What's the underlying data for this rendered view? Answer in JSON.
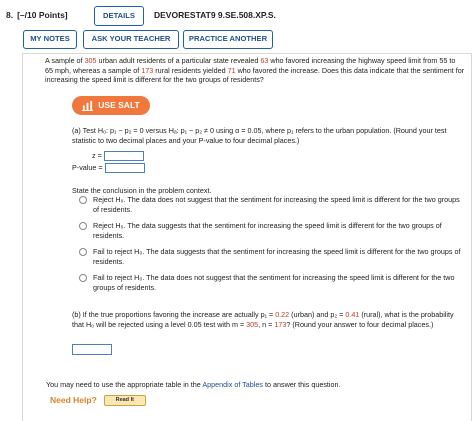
{
  "header": {
    "question_number": "8.",
    "points": "[–/10 Points]",
    "details_label": "DETAILS",
    "question_id": "DEVORESTAT9 9.SE.508.XP.S."
  },
  "toolbar": {
    "my_notes": "MY NOTES",
    "ask_teacher": "ASK YOUR TEACHER",
    "practice": "PRACTICE ANOTHER"
  },
  "problem": {
    "statement_parts": [
      "A sample of ",
      "305",
      " urban adult residents of a particular state revealed ",
      "63",
      " who favored increasing the highway speed limit from 55 to 65 mph, whereas a sample of ",
      "173",
      " rural residents yielded ",
      "71",
      " who favored the increase. Does this data indicate that the sentiment for increasing the speed limit is different for the two groups of residents?"
    ],
    "salt_label": "USE SALT",
    "part_a": "(a) Test H₀: p₁ − p₂ = 0 versus Hₐ: p₁ − p₂ ≠ 0 using α = 0.05, where p₁ refers to the urban population. (Round your test statistic to two decimal places and your P-value to four decimal places.)",
    "z_label": "z =",
    "p_label": "P-value =",
    "conclusion_prompt": "State the conclusion in the problem context.",
    "options": [
      "Reject H₀. The data does not suggest that the sentiment for increasing the speed limit is different for the two groups of residents.",
      "Reject H₀. The data suggests that the sentiment for increasing the speed limit is different for the two groups of residents.",
      "Fail to reject H₀. The data suggests that the sentiment for increasing the speed limit is different for the two groups of residents.",
      "Fail to reject H₀. The data does not suggest that the sentiment for increasing the speed limit is different for the two groups of residents."
    ],
    "part_b_parts": [
      "(b) If the true proportions favoring the increase are actually p₁ = ",
      "0.22",
      " (urban) and p₂ = ",
      "0.41",
      " (rural), what is the probability that H₀ will be rejected using a level 0.05 test with m = ",
      "305",
      ", n = ",
      "173",
      "? (Round your answer to four decimal places.)"
    ]
  },
  "footer": {
    "appendix_before": "You may need to use the appropriate table in the ",
    "appendix_link": "Appendix of Tables",
    "appendix_after": " to answer this question.",
    "need_help": "Need Help?",
    "read_it": "Read It"
  },
  "colors": {
    "accent_blue": "#1f4e8c",
    "highlight_red": "#c0392b",
    "salt_orange": "#f0783c",
    "need_help_orange": "#d9822b"
  }
}
